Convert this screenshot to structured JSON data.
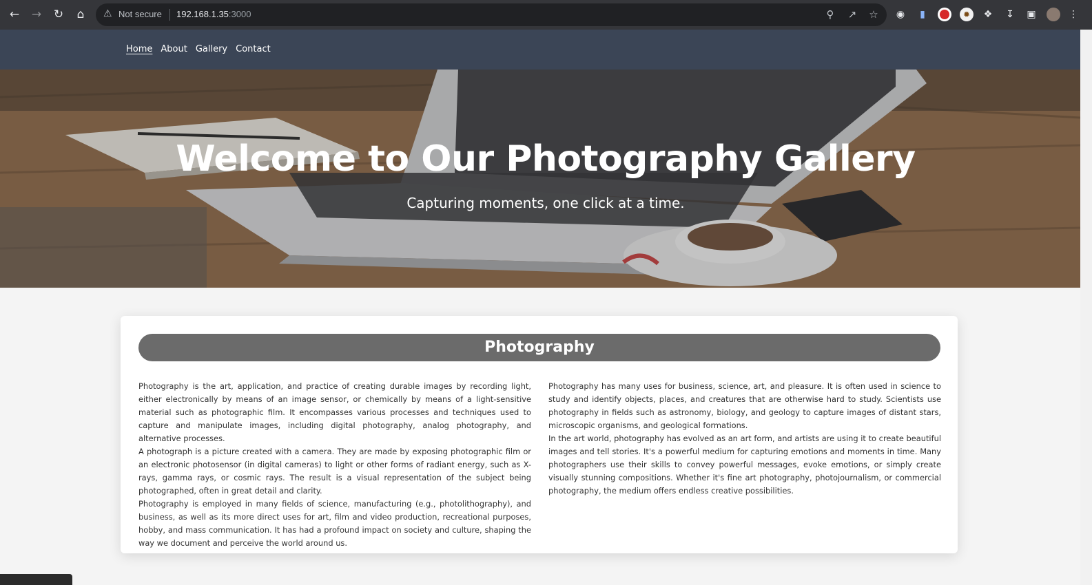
{
  "browser": {
    "security_label": "Not secure",
    "url_host": "192.168.1.35",
    "url_port": ":3000",
    "icons": [
      "back-icon",
      "forward-icon",
      "reload-icon",
      "home-icon",
      "warning-icon",
      "zoom-icon",
      "share-icon",
      "star-icon",
      "extension-icons",
      "download-icon",
      "sidebar-icon",
      "profile-avatar",
      "menu-icon"
    ]
  },
  "site_nav": {
    "items": [
      {
        "label": "Home",
        "active": true
      },
      {
        "label": "About"
      },
      {
        "label": "Gallery"
      },
      {
        "label": "Contact"
      }
    ]
  },
  "hero": {
    "title": "Welcome to Our Photography Gallery",
    "subtitle": "Capturing moments, one click at a time."
  },
  "section": {
    "title": "Photography",
    "left_paragraphs": [
      "Photography is the art, application, and practice of creating durable images by recording light, either electronically by means of an image sensor, or chemically by means of a light-sensitive material such as photographic film. It encompasses various processes and techniques used to capture and manipulate images, including digital photography, analog photography, and alternative processes.",
      "A photograph is a picture created with a camera. They are made by exposing photographic film or an electronic photosensor (in digital cameras) to light or other forms of radiant energy, such as X-rays, gamma rays, or cosmic rays. The result is a visual representation of the subject being photographed, often in great detail and clarity.",
      "Photography is employed in many fields of science, manufacturing (e.g., photolithography), and business, as well as its more direct uses for art, film and video production, recreational purposes, hobby, and mass communication. It has had a profound impact on society and culture, shaping the way we document and perceive the world around us."
    ],
    "right_paragraphs": [
      "Photography has many uses for business, science, art, and pleasure. It is often used in science to study and identify objects, places, and creatures that are otherwise hard to study. Scientists use photography in fields such as astronomy, biology, and geology to capture images of distant stars, microscopic organisms, and geological formations.",
      "In the art world, photography has evolved as an art form, and artists are using it to create beautiful images and tell stories. It's a powerful medium for capturing emotions and moments in time. Many photographers use their skills to convey powerful messages, evoke emotions, or simply create visually stunning compositions. Whether it's fine art photography, photojournalism, or commercial photography, the medium offers endless creative possibilities."
    ]
  },
  "colors": {
    "header_bg": "#3b4556",
    "section_title_bg": "#6b6b6b",
    "page_bg": "#f4f4f4"
  }
}
